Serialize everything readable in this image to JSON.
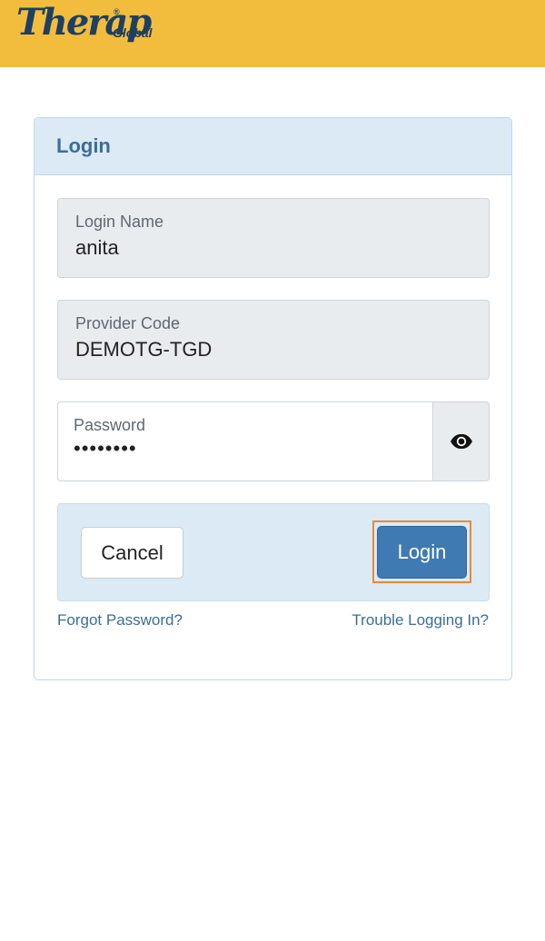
{
  "header": {
    "logo_text": "Therap",
    "logo_reg": "®",
    "logo_sub": "Global",
    "background": "#f2bd3d"
  },
  "card": {
    "title": "Login"
  },
  "fields": {
    "login_name": {
      "label": "Login Name",
      "value": "anita"
    },
    "provider_code": {
      "label": "Provider Code",
      "value": "DEMOTG-TGD"
    },
    "password": {
      "label": "Password",
      "value": "••••••••"
    }
  },
  "icons": {
    "show_password": "eye-icon"
  },
  "buttons": {
    "cancel": "Cancel",
    "login": "Login"
  },
  "links": {
    "forgot_password": "Forgot Password?",
    "trouble": "Trouble Logging In?"
  },
  "colors": {
    "accent": "#3f7ab3",
    "focus_outline": "#e98a32",
    "panel": "#dceaf6"
  }
}
